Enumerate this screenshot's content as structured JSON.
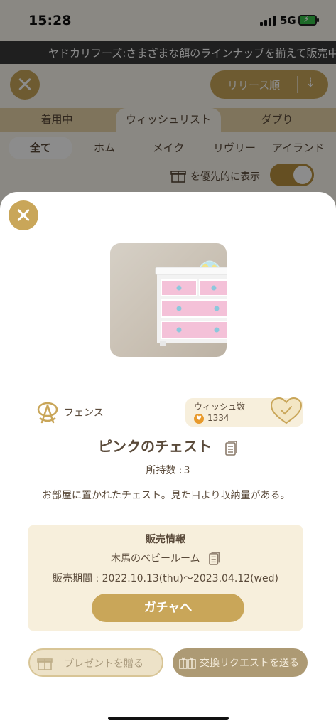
{
  "status": {
    "time": "15:28",
    "network": "5G"
  },
  "ticker": {
    "text": "ヤドカリフーズ:さまざまな餌のラインナップを揃えて販売中"
  },
  "background": {
    "sort_label": "リリース順",
    "tabs": [
      "着用中",
      "ウィッシュリスト",
      "ダブり"
    ],
    "active_tab": "ウィッシュリスト",
    "subtabs": [
      "全て",
      "ホム",
      "メイク",
      "リヴリー",
      "アイランド"
    ],
    "active_subtab": "全て",
    "priority_label": "を優先的に表示",
    "priority_toggle_on": true
  },
  "item": {
    "category": "フェンス",
    "wish_label": "ウィッシュ数",
    "wish_count": "1334",
    "name": "ピンクのチェスト",
    "owned_label": "所持数 :",
    "owned_count": "3",
    "description": "お部屋に置かれたチェスト。見た目より収納量がある。"
  },
  "sale_info": {
    "title": "販売情報",
    "gacha_name": "木馬のベビールーム",
    "period_label": "販売期間 :",
    "period": "2022.10.13(thu)〜2023.04.12(wed)",
    "gacha_button": "ガチャへ"
  },
  "actions": {
    "present_label": "プレゼントを贈る",
    "trade_label": "交換リクエストを送る"
  },
  "colors": {
    "accent": "#c9a659",
    "panel": "#f7efdc",
    "text": "#5a4a3a",
    "wish_badge": "#e89a2c"
  }
}
